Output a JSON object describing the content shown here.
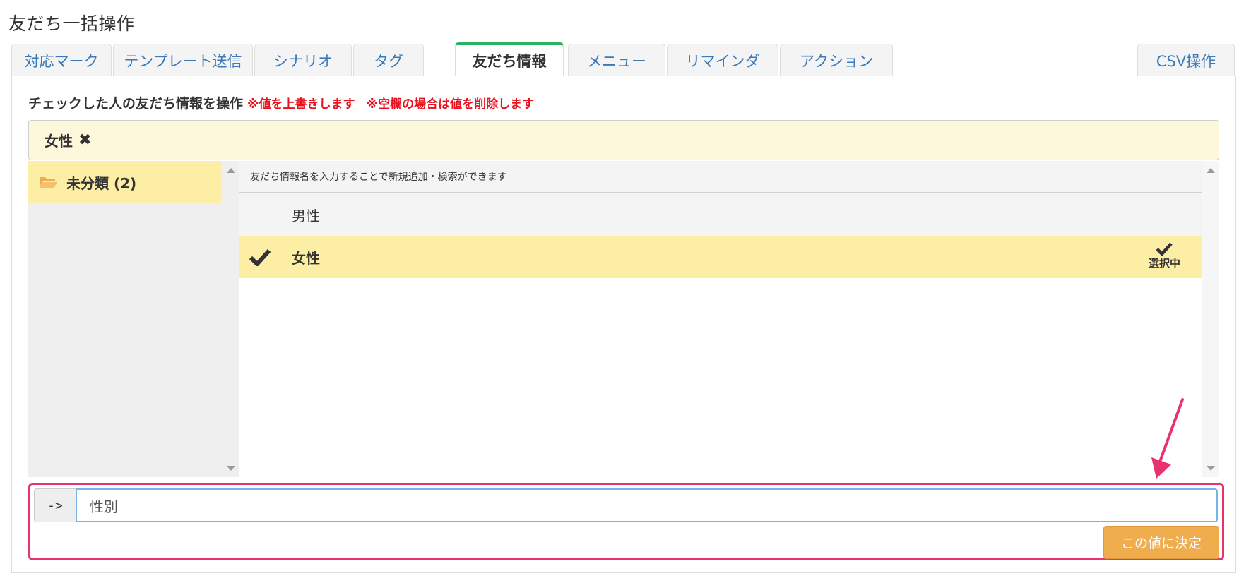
{
  "page": {
    "title": "友だち一括操作"
  },
  "tabs": [
    {
      "label": "対応マーク"
    },
    {
      "label": "テンプレート送信"
    },
    {
      "label": "シナリオ"
    },
    {
      "label": "タグ"
    },
    {
      "label": "友だち情報",
      "active": true
    },
    {
      "label": "メニュー"
    },
    {
      "label": "リマインダ"
    },
    {
      "label": "アクション"
    },
    {
      "label": "CSV操作"
    }
  ],
  "operation": {
    "heading": "チェックした人の友だち情報を操作",
    "warning_overwrite": "※値を上書きします",
    "warning_blank": "※空欄の場合は値を削除します"
  },
  "selected_chip": {
    "label": "女性",
    "remove_icon": "close-icon"
  },
  "folders": [
    {
      "label": "未分類 (2)",
      "icon": "folder-open-icon",
      "active": true
    }
  ],
  "list": {
    "hint": "友だち情報名を入力することで新規追加・検索ができます",
    "items": [
      {
        "label": "男性",
        "checked": false
      },
      {
        "label": "女性",
        "checked": true,
        "status": "選択中"
      }
    ]
  },
  "input": {
    "addon": "->",
    "value": "性別"
  },
  "decide_button": {
    "label": "この値に決定"
  },
  "colors": {
    "active_tab_accent": "#28b463",
    "link_blue": "#3a7ab8",
    "warning_red": "#e8121f",
    "highlight_yellow": "#fdeea6",
    "chip_bg": "#fdf7dc",
    "annotation_pink": "#e8336e",
    "button_orange": "#f0ad4e"
  }
}
